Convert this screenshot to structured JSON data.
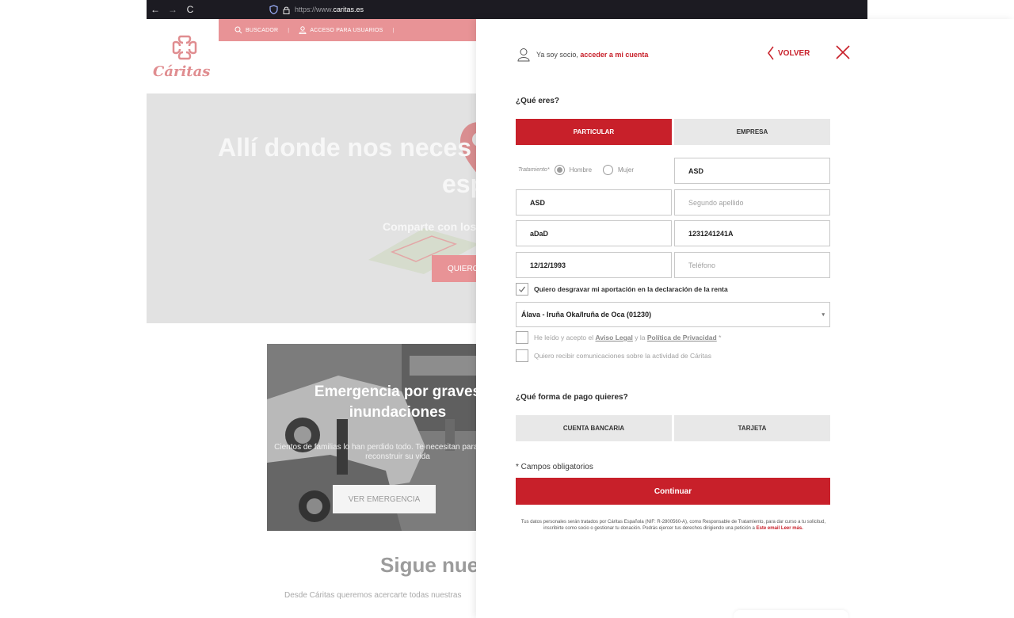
{
  "browser": {
    "back": "←",
    "forward": "→",
    "reload": "C",
    "url_prefix": "https://www.",
    "url_domain": "caritas.es"
  },
  "site": {
    "topbar": {
      "search_label": "BUSCADOR",
      "sep": "|",
      "access_label": "ACCESO PARA USUARIOS",
      "sep2": "|"
    },
    "logo_text": "Cáritas",
    "hero": {
      "title_line1": "Allí donde nos neces",
      "title_line2": "esp",
      "subtitle": "Comparte con los",
      "button": "QUIERO"
    },
    "card": {
      "title": "Emergencia por graves inundaciones",
      "text": "Cientos de familias lo han perdido todo. Te necesitan para ayudarles a reconstruir su vida",
      "button": "VER EMERGENCIA"
    },
    "follow_title": "Sigue nue",
    "follow_sub": "Desde Cáritas queremos acercarte todas nuestras"
  },
  "panel": {
    "member_text": "Ya soy socio, ",
    "member_link": "acceder a mi cuenta",
    "back_label": "VOLVER",
    "who_heading": "¿Qué eres?",
    "type_particular": "PARTICULAR",
    "type_empresa": "EMPRESA",
    "tratamiento_label": "Tratamiento*",
    "radio_hombre": "Hombre",
    "radio_mujer": "Mujer",
    "fields": {
      "nombre": "ASD",
      "apellido1": "ASD",
      "apellido2_placeholder": "Segundo apellido",
      "email": "aDaD",
      "nif": "1231241241A",
      "fecha": "12/12/1993",
      "telefono_placeholder": "Teléfono"
    },
    "desgravar_label": "Quiero desgravar mi aportación en la declaración de la renta",
    "desgravar_checked": true,
    "province_select": "Álava - Iruña Oka/Iruña de Oca (01230)",
    "legal_check": {
      "pre": "He leído y acepto el ",
      "aviso": "Aviso Legal",
      "mid": " y la ",
      "politica": "Política de Privacidad",
      "post": " *"
    },
    "comms_label": "Quiero recibir comunicaciones sobre la actividad de Cáritas",
    "payment_heading": "¿Qué forma de pago quieres?",
    "pay_bank": "CUENTA BANCARIA",
    "pay_card": "TARJETA",
    "required_note": "* Campos obligatorios",
    "continue_label": "Continuar",
    "legal_text": "Tus datos personales serán tratados por Cáritas Española (NIF: R-2800560-A), como Responsable de Tratamiento, para dar curso a tu solicitud, inscribirte como socio o gestionar tu donación. Podrás ejercer tus derechos dirigiendo una petición a ",
    "legal_email": "Este email",
    "legal_more": " Leer más."
  },
  "colors": {
    "brand_red": "#c8202a",
    "brand_pink": "#e89396"
  }
}
